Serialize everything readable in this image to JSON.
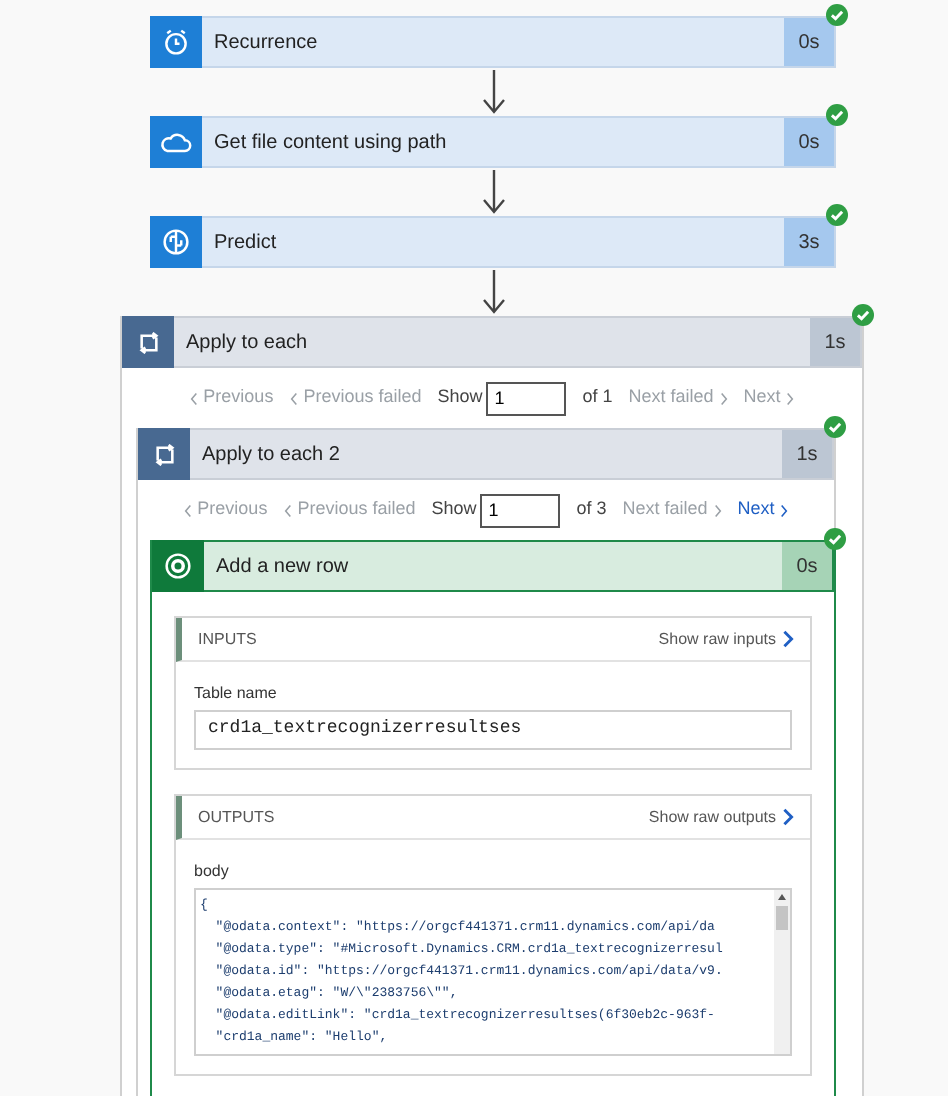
{
  "steps": [
    {
      "kind": "schedule",
      "title": "Recurrence",
      "duration": "0s",
      "succeeded": true
    },
    {
      "kind": "cloud",
      "title": "Get file content using path",
      "duration": "0s",
      "succeeded": true
    },
    {
      "kind": "predict",
      "title": "Predict",
      "duration": "3s",
      "succeeded": true
    }
  ],
  "loop": {
    "title": "Apply to each",
    "duration": "1s",
    "succeeded": true,
    "pager": {
      "previous": "Previous",
      "previous_failed": "Previous failed",
      "show": "Show",
      "value": "1",
      "of": "of 1",
      "next_failed": "Next failed",
      "next": "Next",
      "next_enabled": false
    },
    "inner_loop": {
      "title": "Apply to each 2",
      "duration": "1s",
      "succeeded": true,
      "pager": {
        "previous": "Previous",
        "previous_failed": "Previous failed",
        "show": "Show",
        "value": "1",
        "of": "of 3",
        "next_failed": "Next failed",
        "next": "Next",
        "next_enabled": true
      },
      "action": {
        "title": "Add a new row",
        "duration": "0s",
        "succeeded": true,
        "inputs": {
          "heading": "INPUTS",
          "link": "Show raw inputs",
          "field_label": "Table name",
          "field_value": "crd1a_textrecognizerresultses"
        },
        "outputs": {
          "heading": "OUTPUTS",
          "link": "Show raw outputs",
          "field_label": "body",
          "code_lines": [
            "{",
            "  \"@odata.context\": \"https://orgcf441371.crm11.dynamics.com/api/da",
            "  \"@odata.type\": \"#Microsoft.Dynamics.CRM.crd1a_textrecognizerresul",
            "  \"@odata.id\": \"https://orgcf441371.crm11.dynamics.com/api/data/v9.",
            "  \"@odata.etag\": \"W/\\\"2383756\\\"\",",
            "  \"@odata.editLink\": \"crd1a_textrecognizerresultses(6f30eb2c-963f-",
            "  \"crd1a_name\": \"Hello\","
          ]
        }
      }
    }
  }
}
